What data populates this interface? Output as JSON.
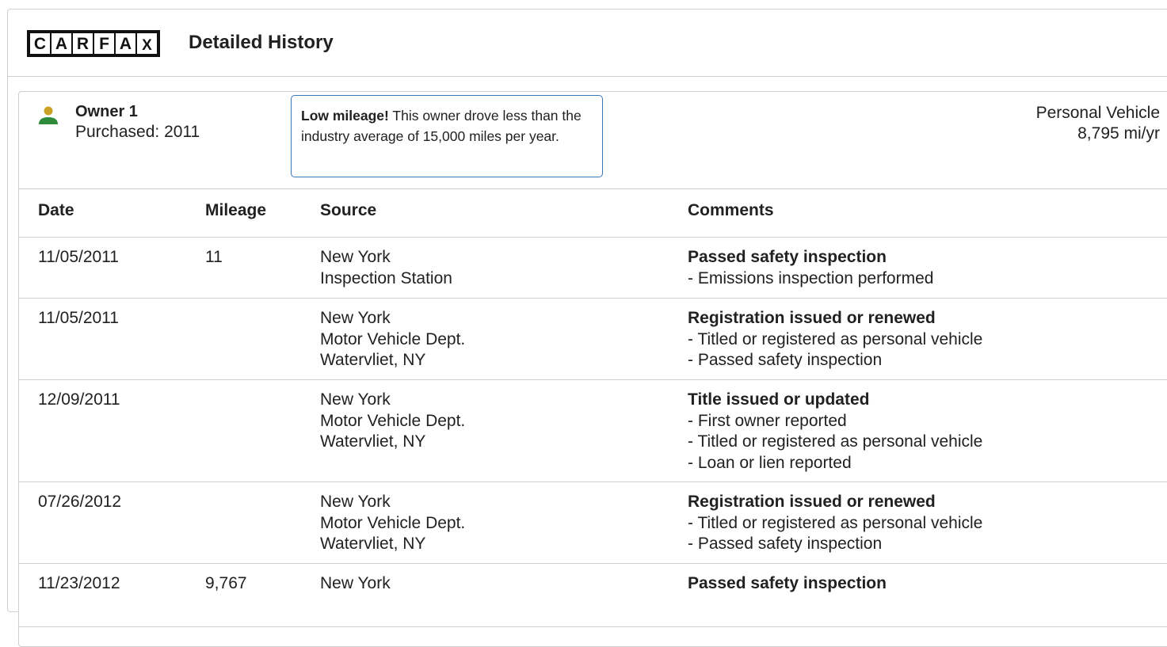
{
  "header": {
    "logo_letters": [
      "C",
      "A",
      "R",
      "F",
      "A",
      "X"
    ],
    "title": "Detailed History"
  },
  "owner": {
    "title": "Owner 1",
    "purchased": "Purchased: 2011",
    "callout_bold": "Low mileage!",
    "callout_text": " This owner drove less than the industry average of 15,000 miles per year.",
    "vehicle_type": "Personal Vehicle",
    "miles_per_year": "8,795 mi/yr",
    "icon_color_head": "#c9a227",
    "icon_color_body": "#2e8b3a"
  },
  "table": {
    "headers": [
      "Date",
      "Mileage",
      "Source",
      "Comments"
    ],
    "rows": [
      {
        "date": "11/05/2011",
        "mileage": "11",
        "source": [
          "New York",
          "Inspection Station"
        ],
        "comment_title": "Passed safety inspection",
        "comment_lines": [
          "Emissions inspection performed"
        ]
      },
      {
        "date": "11/05/2011",
        "mileage": "",
        "source": [
          "New York",
          "Motor Vehicle Dept.",
          "Watervliet, NY"
        ],
        "comment_title": "Registration issued or renewed",
        "comment_lines": [
          "Titled or registered as personal vehicle",
          "Passed safety inspection"
        ]
      },
      {
        "date": "12/09/2011",
        "mileage": "",
        "source": [
          "New York",
          "Motor Vehicle Dept.",
          "Watervliet, NY"
        ],
        "comment_title": "Title issued or updated",
        "comment_lines": [
          "First owner reported",
          "Titled or registered as personal vehicle",
          "Loan or lien reported"
        ]
      },
      {
        "date": "07/26/2012",
        "mileage": "",
        "source": [
          "New York",
          "Motor Vehicle Dept.",
          "Watervliet, NY"
        ],
        "comment_title": "Registration issued or renewed",
        "comment_lines": [
          "Titled or registered as personal vehicle",
          "Passed safety inspection"
        ]
      },
      {
        "date": "11/23/2012",
        "mileage": "9,767",
        "source": [
          "New York"
        ],
        "comment_title": "Passed safety inspection",
        "comment_lines": []
      }
    ]
  }
}
